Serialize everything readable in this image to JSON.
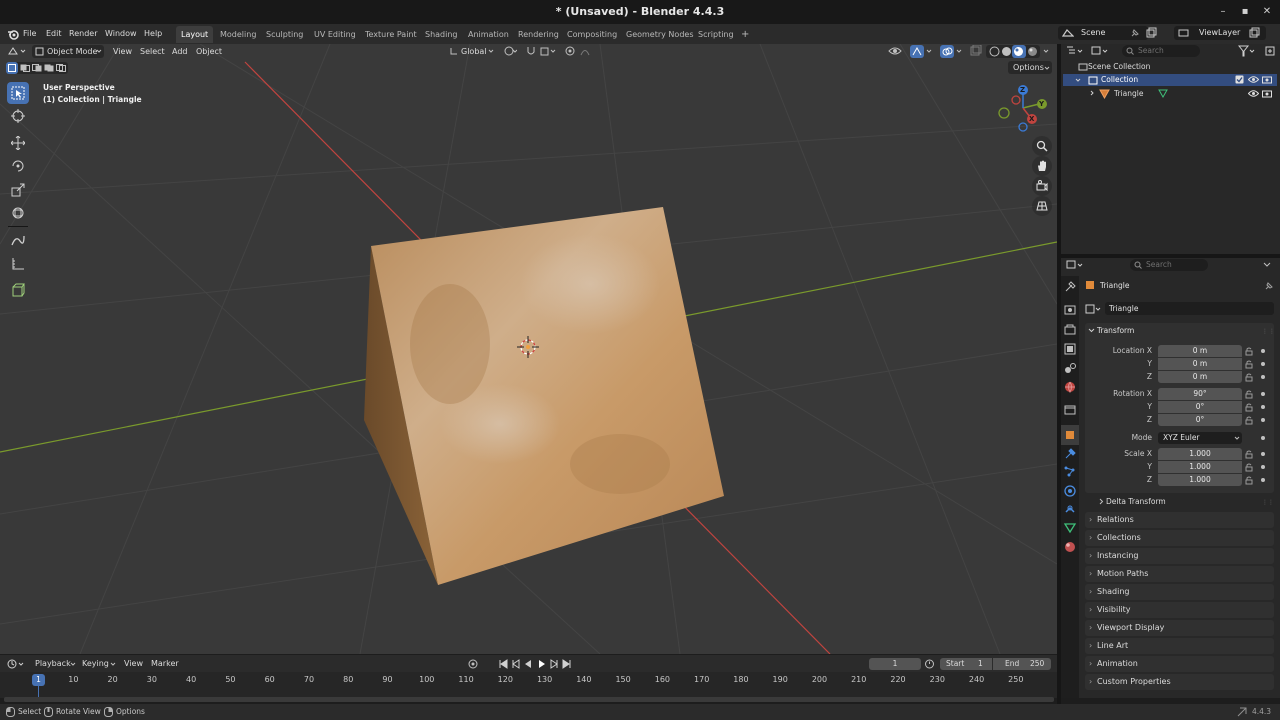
{
  "window": {
    "title": "* (Unsaved) - Blender 4.4.3",
    "minimize": "–",
    "maximize": "▪",
    "close": "✕"
  },
  "menu": [
    "File",
    "Edit",
    "Render",
    "Window",
    "Help"
  ],
  "workspaces": [
    "Layout",
    "Modeling",
    "Sculpting",
    "UV Editing",
    "Texture Paint",
    "Shading",
    "Animation",
    "Rendering",
    "Compositing",
    "Geometry Nodes",
    "Scripting"
  ],
  "workspace_add": "+",
  "scene": {
    "label": "Scene",
    "viewlayer": "ViewLayer"
  },
  "viewport": {
    "mode": "Object Mode",
    "menus": [
      "View",
      "Select",
      "Add",
      "Object"
    ],
    "transform_orientation": "Global",
    "options": "Options",
    "overlay_line1": "User Perspective",
    "overlay_line2": "(1) Collection | Triangle",
    "gizmo": {
      "x": "X",
      "y": "Y",
      "z": "Z"
    }
  },
  "outliner": {
    "search_placeholder": "Search",
    "scene_collection": "Scene Collection",
    "collection": "Collection",
    "object": "Triangle"
  },
  "properties": {
    "search_placeholder": "Search",
    "object_name": "Triangle",
    "object_field": "Triangle",
    "transform_title": "Transform",
    "location_label": "Location X",
    "rotation_label": "Rotation X",
    "mode_label": "Mode",
    "scale_label": "Scale X",
    "axis_y": "Y",
    "axis_z": "Z",
    "location": [
      "0 m",
      "0 m",
      "0 m"
    ],
    "rotation": [
      "90°",
      "0°",
      "0°"
    ],
    "mode_value": "XYZ Euler",
    "scale": [
      "1.000",
      "1.000",
      "1.000"
    ],
    "delta_transform": "Delta Transform",
    "panels": [
      "Relations",
      "Collections",
      "Instancing",
      "Motion Paths",
      "Shading",
      "Visibility",
      "Viewport Display",
      "Line Art",
      "Animation",
      "Custom Properties"
    ]
  },
  "timeline": {
    "menus": [
      "Playback",
      "Keying",
      "View",
      "Marker"
    ],
    "current_frame": "1",
    "start_label": "Start",
    "start_value": "1",
    "end_label": "End",
    "end_value": "250",
    "frame_ticks": [
      "10",
      "20",
      "30",
      "40",
      "50",
      "60",
      "70",
      "80",
      "90",
      "100",
      "110",
      "120",
      "130",
      "140",
      "150",
      "160",
      "170",
      "180",
      "190",
      "200",
      "210",
      "220",
      "230",
      "240",
      "250"
    ],
    "playhead_label": "1"
  },
  "statusbar": {
    "select": "Select",
    "rotate_view": "Rotate View",
    "options": "Options",
    "version": "4.4.3"
  },
  "colors": {
    "accent": "#4772b3",
    "x_axis": "#c0443f",
    "y_axis": "#7a9a2c",
    "cube": "#c89a68"
  }
}
